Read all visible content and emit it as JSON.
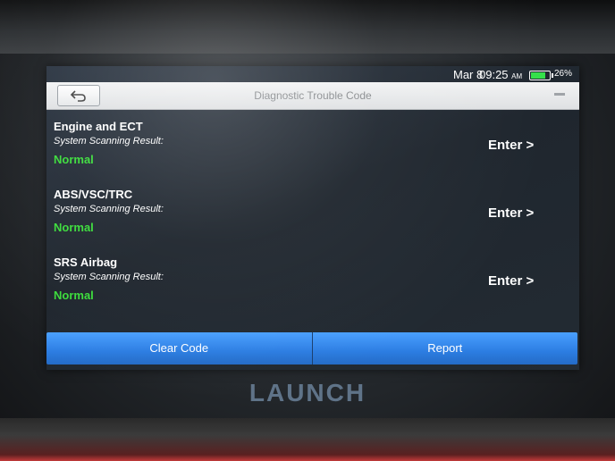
{
  "status": {
    "date": "Mar 8",
    "time": "09:25",
    "ampm": "AM",
    "battery_level": 0.26,
    "battery_text": "26%",
    "battery_color": "#34e04a"
  },
  "header": {
    "title": "Diagnostic Trouble Code",
    "back_icon": "back-arrow-icon",
    "menu_icon": "menu-icon"
  },
  "systems": [
    {
      "name": "Engine and ECT",
      "subtitle": "System Scanning Result:",
      "result": "Normal",
      "enter_label": "Enter >"
    },
    {
      "name": "ABS/VSC/TRC",
      "subtitle": "System Scanning Result:",
      "result": "Normal",
      "enter_label": "Enter >"
    },
    {
      "name": "SRS Airbag",
      "subtitle": "System Scanning Result:",
      "result": "Normal",
      "enter_label": "Enter >"
    }
  ],
  "actions": {
    "clear_label": "Clear Code",
    "report_label": "Report"
  },
  "brand": {
    "name": "LAUNCH"
  },
  "colors": {
    "ok_green": "#3bdc3b",
    "button_blue": "#2c7de2"
  }
}
